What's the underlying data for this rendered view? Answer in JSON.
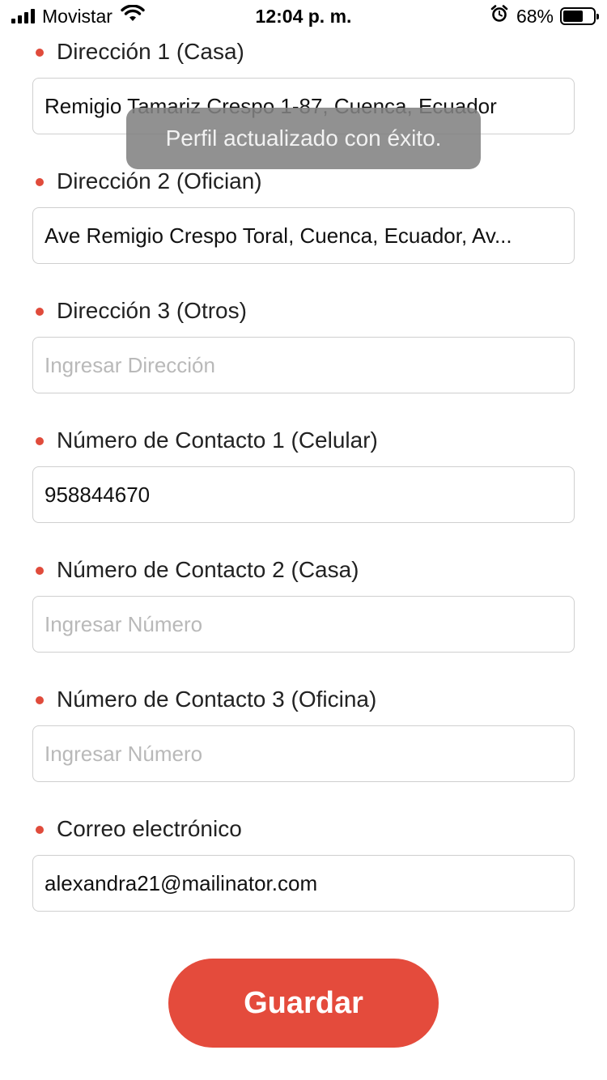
{
  "status_bar": {
    "carrier": "Movistar",
    "time": "12:04 p. m.",
    "battery_percent": "68%",
    "battery_level": 0.68,
    "icons": [
      "signal-icon",
      "wifi-icon",
      "alarm-icon",
      "battery-icon"
    ]
  },
  "toast": {
    "message": "Perfil actualizado con éxito."
  },
  "form": {
    "address_1": {
      "label": "Dirección 1 (Casa)",
      "value": "Remigio Tamariz Crespo 1-87, Cuenca, Ecuador"
    },
    "address_2": {
      "label": "Dirección 2 (Ofician)",
      "value": "Ave Remigio Crespo Toral, Cuenca, Ecuador, Av..."
    },
    "address_3": {
      "label": "Dirección 3 (Otros)",
      "placeholder": "Ingresar Dirección"
    },
    "contact_1": {
      "label": "Número de Contacto 1 (Celular)",
      "value": "958844670"
    },
    "contact_2": {
      "label": "Número de Contacto 2 (Casa)",
      "placeholder": "Ingresar Número"
    },
    "contact_3": {
      "label": "Número de Contacto 3 (Oficina)",
      "placeholder": "Ingresar Número"
    },
    "email": {
      "label": "Correo electrónico",
      "value": "alexandra21@mailinator.com"
    }
  },
  "actions": {
    "save_label": "Guardar"
  },
  "colors": {
    "accent": "#e44b3c",
    "bullet": "#e04b3b",
    "input_border": "#cfcfcf",
    "placeholder": "#b9b9b9",
    "toast_bg": "#828282"
  }
}
